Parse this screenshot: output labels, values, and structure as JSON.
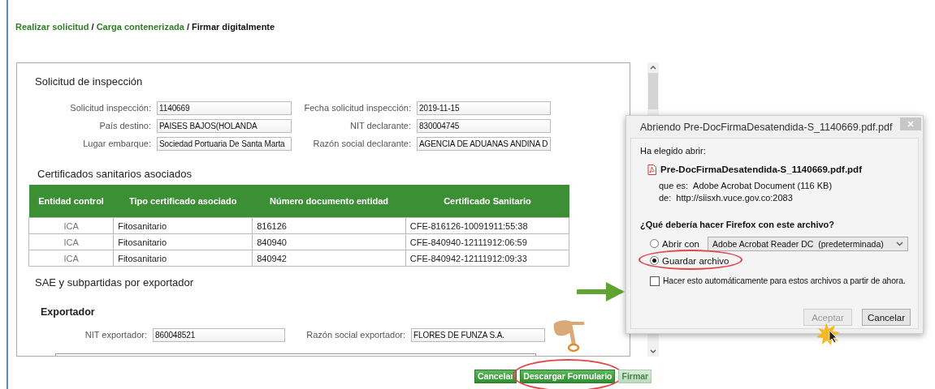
{
  "breadcrumb": [
    {
      "kind": "link",
      "label": "Realizar solicitud"
    },
    {
      "kind": "separator",
      "label": "/"
    },
    {
      "kind": "link",
      "label": "Carga contenerizada"
    },
    {
      "kind": "separator",
      "label": "/"
    },
    {
      "kind": "current",
      "label": "Firmar digitalmente"
    }
  ],
  "solicitud": {
    "title": "Solicitud de inspección",
    "fields": [
      {
        "label": "Solicitud inspección:",
        "value": "1140669"
      },
      {
        "label": "Fecha solicitud inspección:",
        "value": "2019-11-15"
      },
      {
        "label": "País destino:",
        "value": "PAISES BAJOS(HOLANDA"
      },
      {
        "label": "NIT declarante:",
        "value": "830004745"
      },
      {
        "label": "Lugar embarque:",
        "value": "Sociedad Portuaria De Santa Marta"
      },
      {
        "label": "Razón social declarante:",
        "value": "AGENCIA DE ADUANAS ANDINA D"
      }
    ]
  },
  "certificados": {
    "title": "Certificados sanitarios asociados",
    "columns": [
      "Entidad control",
      "Tipo certificado asociado",
      "Número documento entidad",
      "Certificado Sanitario"
    ],
    "rows": [
      [
        "ICA",
        "Fitosanitario",
        "816126",
        "CFE-816126-10091911:55:38"
      ],
      [
        "ICA",
        "Fitosanitario",
        "840940",
        "CFE-840940-12111912:06:59"
      ],
      [
        "ICA",
        "Fitosanitario",
        "840942",
        "CFE-840942-12111912:09:33"
      ]
    ]
  },
  "sae": {
    "title": "SAE y subpartidas por exportador",
    "exportador": {
      "title": "Exportador",
      "fields": [
        {
          "label": "NIT exportador:",
          "value": "860048521"
        },
        {
          "label": "Razón social exportador:",
          "value": "FLORES DE FUNZA S.A."
        }
      ]
    }
  },
  "buttons": [
    {
      "label": "Cancelar",
      "disabled": false,
      "highlighted": false
    },
    {
      "label": "Descargar Formulario",
      "disabled": false,
      "highlighted": true
    },
    {
      "label": "Firmar",
      "disabled": true,
      "highlighted": false
    }
  ],
  "dialog": {
    "title": "Abriendo Pre-DocFirmaDesatendida-S_1140669.pdf.pdf",
    "intro": "Ha elegido abrir:",
    "file_name": "Pre-DocFirmaDesatendida-S_1140669.pdf.pdf",
    "type_label": "que es:",
    "type_value": "Adobe Acrobat Document (116 KB)",
    "from_label": "de:",
    "from_value": "http://siisxh.vuce.gov.co:2083",
    "question": "¿Qué debería hacer Firefox con este archivo?",
    "options": [
      {
        "label": "Abrir con",
        "selected": false,
        "highlighted": false,
        "app": "Adobe Acrobat Reader DC  (predeterminada)"
      },
      {
        "label": "Guardar archivo",
        "selected": true,
        "highlighted": true
      }
    ],
    "remember": {
      "label": "Hacer esto automáticamente para estos archivos a partir de ahora.",
      "checked": false
    },
    "buttons": [
      {
        "label": "Aceptar",
        "disabled": true
      },
      {
        "label": "Cancelar",
        "disabled": false
      }
    ]
  }
}
